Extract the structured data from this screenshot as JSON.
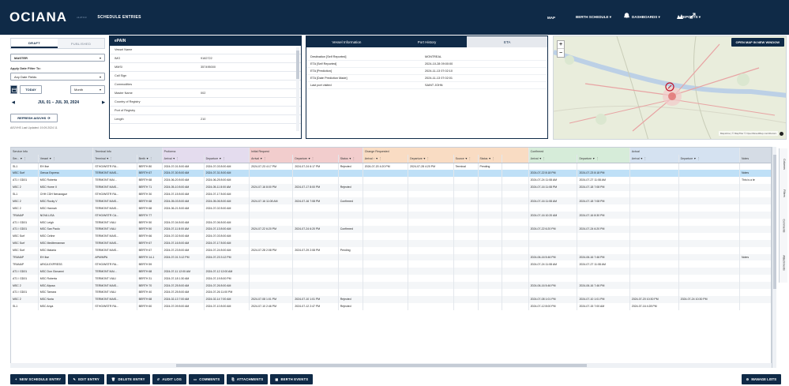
{
  "topbar": {
    "logo": "OCIANA",
    "tagline": "v1.27.0.0",
    "page_title": "SCHEDULE ENTRIES",
    "nav": [
      {
        "label": "MAP"
      },
      {
        "label": "BERTH SCHEDULE  ▾"
      },
      {
        "label": "DASHBOARDS  ▾"
      },
      {
        "label": "REPORTS  ▾"
      }
    ]
  },
  "left": {
    "tab_draft": "DRAFT",
    "tab_published": "PUBLISHED",
    "mode_select": "MASTER",
    "filter_label": "Apply Date Filter To:",
    "filter_select": "Any Date Fields",
    "today_btn": "TODAY",
    "period_select": "Month",
    "date_range": "JUL 01 – JUL 30, 2024",
    "refresh_btn": "REFRESH AIS/VHS",
    "last_updated": "AIS/VHS Last Updated: 19.09.2024 11"
  },
  "vessel": {
    "title": "ePAIN",
    "rows": [
      {
        "k": "Vessel Name",
        "v": ""
      },
      {
        "k": "IMO",
        "v": "9182722"
      },
      {
        "k": "MMSI",
        "v": "357495000"
      },
      {
        "k": "Call Sign",
        "v": ""
      },
      {
        "k": "Commodities",
        "v": ""
      },
      {
        "k": "Master Name",
        "v": "002"
      },
      {
        "k": "Country of Registry",
        "v": ""
      },
      {
        "k": "Port of Registry",
        "v": ""
      },
      {
        "k": "Length",
        "v": "210"
      }
    ]
  },
  "vtabs": {
    "tabs": [
      {
        "label": "Vessel Information"
      },
      {
        "label": "Port History"
      },
      {
        "label": "ETA"
      }
    ],
    "rows": [
      {
        "k": "Destination [Self Reported]",
        "v": "MONTREAL"
      },
      {
        "k": "ETA [Self Reported]",
        "v": "2024-10-28 09:00:00"
      },
      {
        "k": "ETA [Prediction]",
        "v": "2024-11-13 07:02:10"
      },
      {
        "k": "ETA [Date Prediction Made]",
        "v": "2024-11-13 07:02:01"
      },
      {
        "k": "Last port visited",
        "v": "SAINT JOHN"
      }
    ]
  },
  "map": {
    "open_btn": "OPEN MAP IN NEW WINDOW",
    "zoom_in": "+",
    "zoom_out": "−",
    "attribution": "MapLibre | © MapTiler © OpenStreetMap contributors"
  },
  "table": {
    "groups": [
      {
        "label": "Service Info",
        "span": 2,
        "cls": "g-service"
      },
      {
        "label": "Terminal Info",
        "span": 2,
        "cls": "g-terminal"
      },
      {
        "label": "Proforma",
        "span": 2,
        "cls": "g-proforma"
      },
      {
        "label": "Initial Request",
        "span": 3,
        "cls": "g-initial"
      },
      {
        "label": "Change Requested",
        "span": 5,
        "cls": "g-change"
      },
      {
        "label": "Confirmed",
        "span": 2,
        "cls": "g-confirmed"
      },
      {
        "label": "Actual",
        "span": 2,
        "cls": "g-actual"
      },
      {
        "label": "",
        "span": 1,
        "cls": "g-notes"
      }
    ],
    "columns": [
      {
        "label": "Ser... ▼ ⋮",
        "w": 31,
        "cls": "g-service"
      },
      {
        "label": "Vessel          ▼ ⋮",
        "w": 63,
        "cls": "g-service"
      },
      {
        "label": "Terminal   ▼ ⋮",
        "w": 50,
        "cls": "g-terminal"
      },
      {
        "label": "Berth   ▼ ⋮",
        "w": 29,
        "cls": "g-terminal"
      },
      {
        "label": "Arrival   ▼ ⋮",
        "w": 48,
        "cls": "g-proforma"
      },
      {
        "label": "Departure   ▼ ⋮",
        "w": 52,
        "cls": "g-proforma"
      },
      {
        "label": "Arrival   ▼ ⋮",
        "w": 50,
        "cls": "g-initial"
      },
      {
        "label": "Departure   ▼ ⋮",
        "w": 52,
        "cls": "g-initial"
      },
      {
        "label": "Status ▼ ⋮",
        "w": 28,
        "cls": "g-initial"
      },
      {
        "label": "Arrival ↑   ▼ ⋮",
        "w": 52,
        "cls": "g-change"
      },
      {
        "label": "Departure   ▼ ⋮",
        "w": 52,
        "cls": "g-change"
      },
      {
        "label": "Source ▼ ⋮",
        "w": 28,
        "cls": "g-change"
      },
      {
        "label": "Status ▼ ⋮",
        "w": 28,
        "cls": "g-change"
      },
      {
        "label": "",
        "w": 30,
        "cls": "g-change"
      },
      {
        "label": "Arrival   ▼ ⋮",
        "w": 56,
        "cls": "g-confirmed"
      },
      {
        "label": "Departure   ▼ ⋮",
        "w": 60,
        "cls": "g-confirmed"
      },
      {
        "label": "Arrival   ▼ ⋮",
        "w": 56,
        "cls": "g-actual"
      },
      {
        "label": "Departure   ▼ ⋮",
        "w": 70,
        "cls": "g-actual"
      },
      {
        "label": "Notes",
        "w": 37,
        "cls": "g-notes"
      }
    ],
    "rows": [
      {
        "sel": false,
        "cells": [
          "SL1",
          "EH Ilse",
          "STHG/WSTR RA...",
          "BERTH 80",
          "2024-07-01 8:00 AM",
          "2024-07-03 8:00 AM",
          "2024-07-23 4:17 PM",
          "2024-07-24 6:17 PM",
          "Rejected",
          "2024-07-20 4:20 PM",
          "2024-07-28 4:20 PM",
          "Terminal",
          "Pending",
          "",
          "",
          "",
          "",
          "",
          ""
        ]
      },
      {
        "sel": true,
        "cells": [
          "MSC Surf",
          "Genoa Express",
          "TERMONT MAIS...",
          "BERTH 67",
          "2024-07-30 8:00 AM",
          "2024-07-31 8:00 AM",
          "",
          "",
          "",
          "",
          "",
          "",
          "",
          "",
          "2024-07-22 8:18 PM",
          "2024-07-23 8:18 PM",
          "",
          "",
          "Notes"
        ]
      },
      {
        "sel": false,
        "cells": [
          "AT1 / GD01",
          "MSC Roberta",
          "TERMONT MAI...",
          "BERTH 68",
          "2024-06-20 8:00 AM",
          "2024-06-25 8:00 AM",
          "",
          "",
          "",
          "",
          "",
          "",
          "",
          "",
          "2024-07-24 11:08 AM",
          "2024-07-27 11:08 AM",
          "",
          "",
          "This is a te"
        ]
      },
      {
        "sel": false,
        "cells": [
          "MSC 2",
          "MSC Home II",
          "TERMONT MAIS...",
          "BERTH 71",
          "2024-05-10 8:00 AM",
          "2024-05-11 8:00 AM",
          "2024-07-16 8:00 PM",
          "2024-07-17 8:00 PM",
          "Rejected",
          "",
          "",
          "",
          "",
          "",
          "2024-07-16 11:08 PM",
          "2024-07-18 7:08 PM",
          "",
          "",
          ""
        ]
      },
      {
        "sel": false,
        "cells": [
          "SL1",
          "CHH CDH Nenarague",
          "STHG/WSTR RA...",
          "BERTH 30",
          "2024-07-15 8:00 AM",
          "2024-07-17 8:00 AM",
          "",
          "",
          "",
          "",
          "",
          "",
          "",
          "",
          "",
          "",
          "",
          "",
          ""
        ]
      },
      {
        "sel": false,
        "cells": [
          "MSC 2",
          "MSC Rocky V",
          "TERMONT MAIS...",
          "BERTH 68",
          "2024-05-03 8:00 AM",
          "2024-05-06 8:00 AM",
          "2024-07-16 11:08 AM",
          "2024-07-16 7:08 PM",
          "Confirmed",
          "",
          "",
          "",
          "",
          "",
          "2024-07-16 11:08 AM",
          "2024-07-18 7:08 PM",
          "",
          "",
          ""
        ]
      },
      {
        "sel": false,
        "cells": [
          "MSC 2",
          "MSC Hannah",
          "TERMONT MAIS...",
          "BERTH 68",
          "2024-06-21 8:00 AM",
          "2024-07-02 8:00 AM",
          "",
          "",
          "",
          "",
          "",
          "",
          "",
          "",
          "",
          "",
          "",
          "",
          ""
        ]
      },
      {
        "sel": false,
        "cells": [
          "TRANAP",
          "NOVA LISA",
          "STHG/WSTR CA...",
          "BERTH 77",
          "",
          "",
          "",
          "",
          "",
          "",
          "",
          "",
          "",
          "",
          "2024-07-16 10:20 AM",
          "2024-07-16 8:30 PM",
          "",
          "",
          ""
        ]
      },
      {
        "sel": false,
        "cells": [
          "AT1 / GD01",
          "MSC Leigh",
          "TERMONT VIAU",
          "BERTH 50",
          "2024-07-04 8:00 AM",
          "2024-07-06 8:00 AM",
          "",
          "",
          "",
          "",
          "",
          "",
          "",
          "",
          "",
          "",
          "",
          "",
          ""
        ]
      },
      {
        "sel": false,
        "cells": [
          "AT1 / GD01",
          "MSC San Paolo",
          "TERMONT VIAU",
          "BERTH 50",
          "2024-07-11 8:00 AM",
          "2024-07-13 8:00 AM",
          "2024-07-22 6:20 PM",
          "2024-07-24 6:20 PM",
          "Confirmed",
          "",
          "",
          "",
          "",
          "",
          "2024-07-22 6:20 PM",
          "2024-07-24 6:20 PM",
          "",
          "",
          ""
        ]
      },
      {
        "sel": false,
        "cells": [
          "MSC Surf",
          "MSC Celine",
          "TERMONT MAIS...",
          "BERTH 66",
          "2024-07-02 8:00 AM",
          "2024-07-03 8:00 AM",
          "",
          "",
          "",
          "",
          "",
          "",
          "",
          "",
          "",
          "",
          "",
          "",
          ""
        ]
      },
      {
        "sel": false,
        "cells": [
          "MSC Surf",
          "MSC Mediterranean",
          "TERMONT MAIS...",
          "BERTH 67",
          "2024-07-16 8:00 AM",
          "2024-07-17 8:00 AM",
          "",
          "",
          "",
          "",
          "",
          "",
          "",
          "",
          "",
          "",
          "",
          "",
          ""
        ]
      },
      {
        "sel": false,
        "cells": [
          "MSC Surf",
          "MSC Malaria",
          "TERMONT MAIS...",
          "BERTH 67",
          "2024-07-23 8:00 AM",
          "2024-07-24 8:00 AM",
          "2024-07-28 2:08 PM",
          "2024-07-29 2:08 PM",
          "Pending",
          "",
          "",
          "",
          "",
          "",
          "",
          "",
          "",
          "",
          ""
        ]
      },
      {
        "sel": false,
        "cells": [
          "TRANAP",
          "EH Ilse",
          "APM/MPA",
          "BERTH 14-1",
          "2024-07-01 3:12 PM",
          "2024-07-23 3:12 PM",
          "",
          "",
          "",
          "",
          "",
          "",
          "",
          "",
          "2024-06-16 5:46 PM",
          "2024-06-16 7:46 PM",
          "",
          "",
          "Notes"
        ]
      },
      {
        "sel": false,
        "cells": [
          "TRANAP",
          "ARICA EXPRESS",
          "STHG/WSTR RA...",
          "BERTH 59",
          "",
          "",
          "",
          "",
          "",
          "",
          "",
          "",
          "",
          "",
          "2024-07-24 11:08 AM",
          "2024-07-27 11:08 AM",
          "",
          "",
          ""
        ]
      },
      {
        "sel": false,
        "cells": [
          "AT1 / GD01",
          "MSC Don Giovanni",
          "TERMONT MAI...",
          "BERTH 68",
          "2024-07-11 12:00 AM",
          "2024-07-12 12:00 AM",
          "",
          "",
          "",
          "",
          "",
          "",
          "",
          "",
          "",
          "",
          "",
          "",
          ""
        ]
      },
      {
        "sel": false,
        "cells": [
          "AT1 / GD01",
          "MSC Roberta",
          "TERMONT VIAU",
          "BERTH 31",
          "2024-07-18 1:30 AM",
          "2024-07-19 8:00 PM",
          "",
          "",
          "",
          "",
          "",
          "",
          "",
          "",
          "",
          "",
          "",
          "",
          ""
        ]
      },
      {
        "sel": false,
        "cells": [
          "MSC 2",
          "MSC Alyssa",
          "TERMONT MAIS...",
          "BERTH 70",
          "2024-07-25 8:00 AM",
          "2024-07-26 8:00 AM",
          "",
          "",
          "",
          "",
          "",
          "",
          "",
          "",
          "2024-06-16 5:46 PM",
          "2024-06-16 7:46 PM",
          "",
          "",
          ""
        ]
      },
      {
        "sel": false,
        "cells": [
          "AT1 / GD01",
          "MSC Tamara",
          "TERMONT VIAU",
          "BERTH 40",
          "2024-07-25 8:00 AM",
          "2024-07-26 11:00 PM",
          "",
          "",
          "",
          "",
          "",
          "",
          "",
          "",
          "",
          "",
          "",
          "",
          ""
        ]
      },
      {
        "sel": false,
        "cells": [
          "MSC 2",
          "MSC Nuria",
          "TERMONT MAIS...",
          "BERTH 68",
          "2024-02-13 7:00 AM",
          "2024-02-14 7:00 AM",
          "2024-07-08 1:01 PM",
          "2024-07-10 1:01 PM",
          "Rejected",
          "",
          "",
          "",
          "",
          "",
          "2024-07-08 1:01 PM",
          "2024-07-10 1:01 PM",
          "2024-07-20 10:30 PM",
          "2024-07-24 10:30 PM",
          ""
        ]
      },
      {
        "sel": false,
        "cells": [
          "SL1",
          "MSC Anya",
          "STHG/WSTR RA...",
          "BERTH 60",
          "2024-07-09 8:00 AM",
          "2024-07-10 8:00 AM",
          "2024-07-10 2:46 PM",
          "2024-07-12 2:47 PM",
          "Rejected",
          "",
          "",
          "",
          "",
          "",
          "2024-07-12 8:00 PM",
          "2024-07-15 7:00 AM",
          "2024-07-16 4:28 PM",
          "",
          ""
        ]
      }
    ]
  },
  "sidetabs": [
    "Columns",
    "Filters",
    "Comments",
    "Attachments"
  ],
  "toolbar": {
    "buttons": [
      {
        "label": "NEW SCHEDULE ENTRY",
        "icon": "+"
      },
      {
        "label": "EDIT ENTRY",
        "icon": "✎"
      },
      {
        "label": "DELETE ENTRY",
        "icon": "🗑"
      },
      {
        "label": "AUDIT LOG",
        "icon": "↺"
      },
      {
        "label": "COMMENTS",
        "icon": "▭"
      },
      {
        "label": "ATTACHMENTS",
        "icon": "⎘"
      },
      {
        "label": "BERTH EVENTS",
        "icon": "▦"
      }
    ],
    "manage": "MANAGE LISTS"
  }
}
